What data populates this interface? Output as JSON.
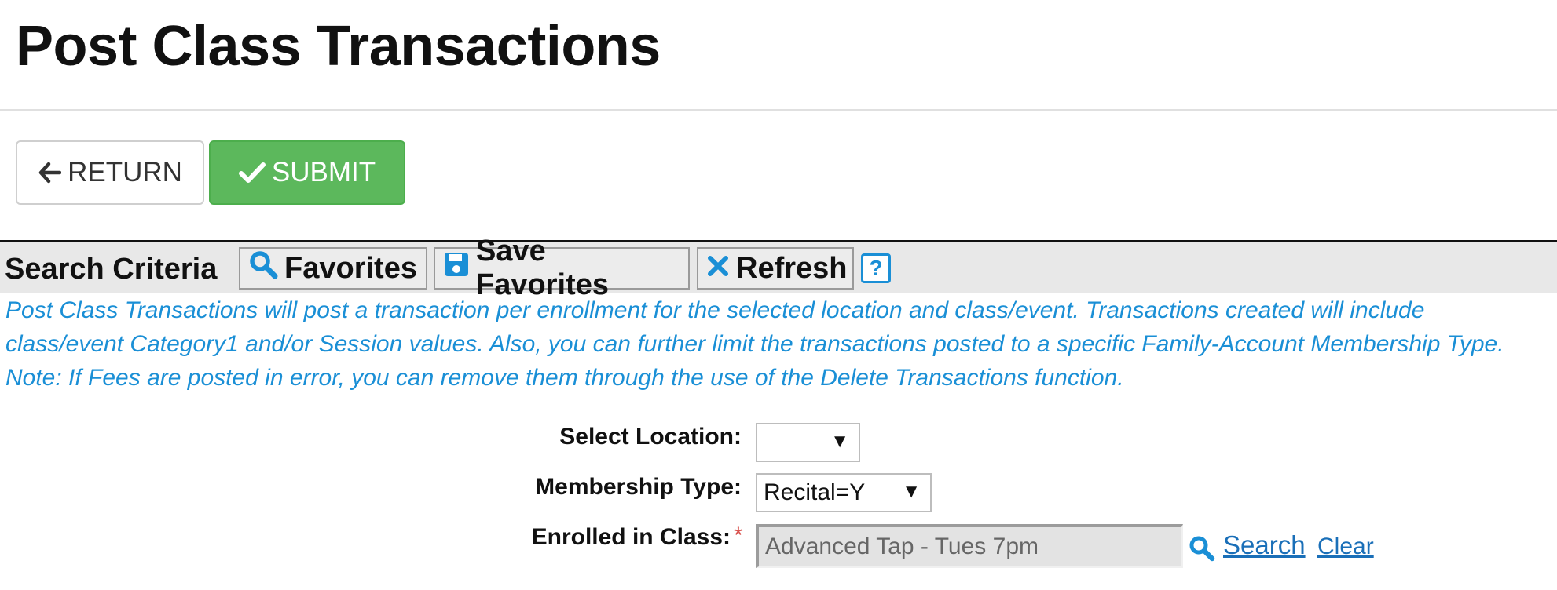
{
  "page": {
    "title": "Post Class Transactions"
  },
  "actions": {
    "return_label": "RETURN",
    "submit_label": "SUBMIT"
  },
  "search_criteria": {
    "title": "Search Criteria",
    "favorites_label": "Favorites",
    "save_favorites_label": "Save Favorites",
    "refresh_label": "Refresh",
    "help_label": "?"
  },
  "description": {
    "lines": [
      "Post Class Transactions will post a transaction per enrollment for the selected location and class/event. Transactions created will include",
      "class/event Category1 and/or Session values.  Also, you can further limit the transactions posted to a specific Family-Account Membership Type.",
      "Note: If Fees are posted in error, you can remove them through the use of the Delete Transactions function."
    ]
  },
  "form": {
    "location_label": "Select Location:",
    "location_value": "",
    "membership_label": "Membership Type:",
    "membership_value": "Recital=Y",
    "enrolled_label": "Enrolled in Class:",
    "required_marker": "*",
    "enrolled_value": "Advanced Tap - Tues 7pm",
    "search_link": "Search",
    "clear_link": "Clear"
  },
  "icons": {
    "return": "arrow-left-icon",
    "submit": "checkmark-icon",
    "favorites": "search-icon",
    "save_favorites": "floppy-disk-icon",
    "refresh": "x-icon",
    "help": "help-icon",
    "dropdown": "triangle-down-icon",
    "class_search": "search-icon"
  },
  "colors": {
    "submit_bg": "#5cb85c",
    "accent_blue": "#1a8fd6",
    "link_blue": "#1a6fb8",
    "required_red": "#d9534f",
    "criteria_bar_bg": "#e8e8e8"
  }
}
